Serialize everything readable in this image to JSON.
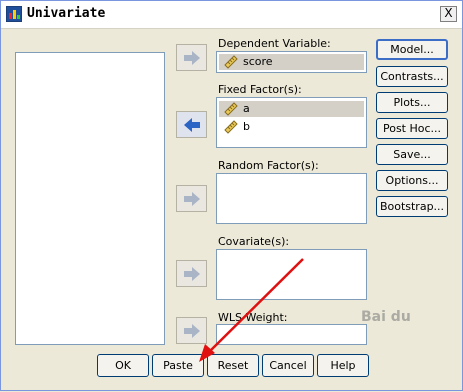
{
  "window": {
    "title": "Univariate",
    "close_label": "X"
  },
  "fields": {
    "dependent": {
      "label": "Dependent Variable:",
      "items": [
        "score"
      ]
    },
    "fixed": {
      "label": "Fixed Factor(s):",
      "items": [
        "a",
        "b"
      ]
    },
    "random": {
      "label": "Random Factor(s):"
    },
    "covariate": {
      "label": "Covariate(s):"
    },
    "wls": {
      "label": "WLS Weight:"
    }
  },
  "side_buttons": [
    "Model...",
    "Contrasts...",
    "Plots...",
    "Post Hoc...",
    "Save...",
    "Options...",
    "Bootstrap..."
  ],
  "bottom_buttons": [
    "OK",
    "Paste",
    "Reset",
    "Cancel",
    "Help"
  ],
  "watermark": "Bai du"
}
